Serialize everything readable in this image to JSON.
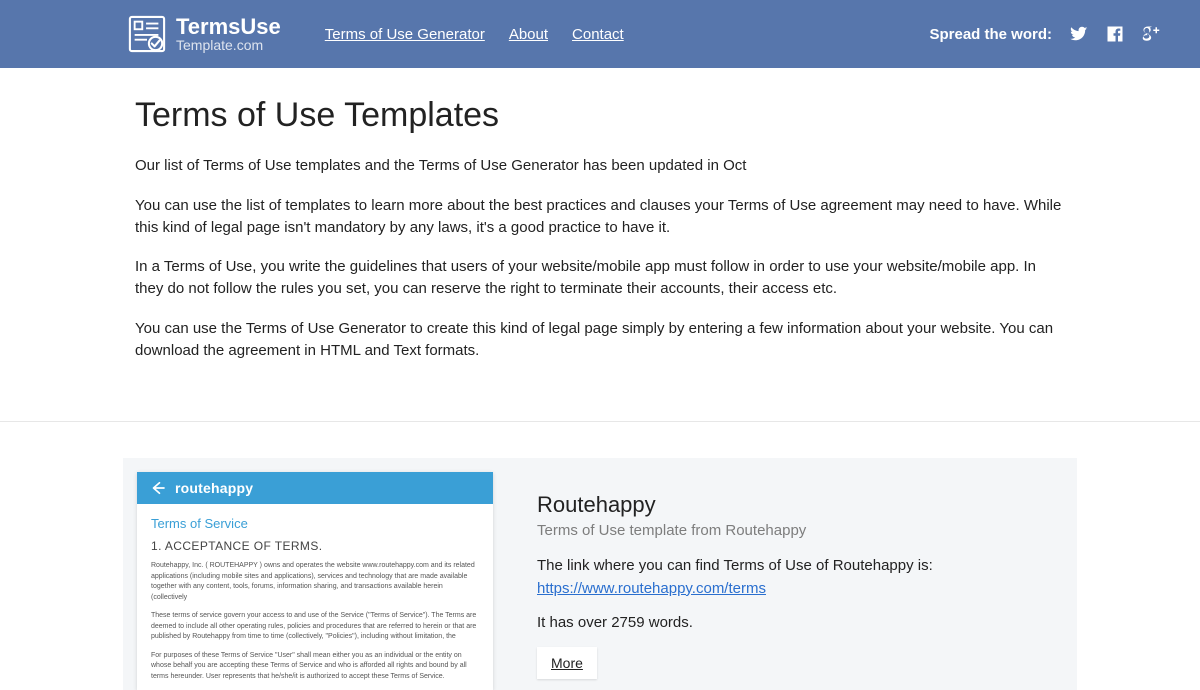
{
  "brand": {
    "top": "TermsUse",
    "bottom": "Template.com"
  },
  "nav": {
    "generator": "Terms of Use Generator",
    "about": "About",
    "contact": "Contact"
  },
  "spread": {
    "label": "Spread the word:"
  },
  "main": {
    "title": "Terms of Use Templates",
    "p1": "Our list of Terms of Use templates and the Terms of Use Generator has been updated in Oct",
    "p2": "You can use the list of templates to learn more about the best practices and clauses your Terms of Use agreement may need to have. While this kind of legal page isn't mandatory by any laws, it's a good practice to have it.",
    "p3": "In a Terms of Use, you write the guidelines that users of your website/mobile app must follow in order to use your website/mobile app. In they do not follow the rules you set, you can reserve the right to terminate their accounts, their access etc.",
    "p4": "You can use the Terms of Use Generator to create this kind of legal page simply by entering a few information about your website. You can download the agreement in HTML and Text formats."
  },
  "card": {
    "thumb": {
      "brand": "routehappy",
      "heading": "Terms of Service",
      "section1": "1. ACCEPTANCE OF TERMS.",
      "micro1": "Routehappy, Inc. ( ROUTEHAPPY ) owns and operates the website www.routehappy.com and its related applications (including mobile sites and applications), services and technology that are made available together with any content, tools, forums, information sharing, and transactions available herein (collectively",
      "micro2": "These terms of service govern your access to and use of the Service (\"Terms of Service\"). The Terms are deemed to include all other operating rules, policies and procedures that are referred to herein or that are published by Routehappy from time to time (collectively, \"Policies\"), including without limitation, the",
      "micro3": "For purposes of these Terms of Service \"User\" shall mean either you as an individual or the entity on whose behalf you are accepting these Terms of Service and who is afforded all rights and bound by all terms hereunder. User represents that he/she/it is authorized to accept these Terms of Service."
    },
    "title": "Routehappy",
    "subtitle": "Terms of Use template from Routehappy",
    "link_intro": "The link where you can find Terms of Use of Routehappy is:",
    "link_url": "https://www.routehappy.com/terms",
    "words_line": "It has over 2759 words.",
    "more": "More"
  }
}
